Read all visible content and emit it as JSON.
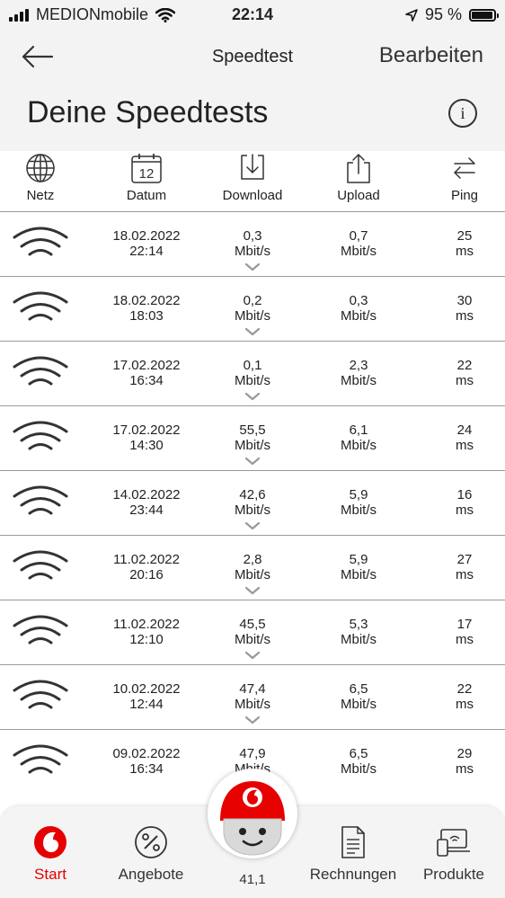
{
  "status": {
    "carrier": "MEDIONmobile",
    "time": "22:14",
    "battery": "95 %",
    "battery_level": 0.95
  },
  "header": {
    "nav_title": "Speedtest",
    "edit_label": "Bearbeiten",
    "page_title": "Deine Speedtests",
    "info_symbol": "i"
  },
  "columns": {
    "network": "Netz",
    "date": "Datum",
    "date_icon_day": "12",
    "download": "Download",
    "upload": "Upload",
    "ping": "Ping"
  },
  "rows": [
    {
      "date": "18.02.2022",
      "time": "22:14",
      "download": "0,3",
      "download_unit": "Mbit/s",
      "upload": "0,7",
      "upload_unit": "Mbit/s",
      "ping": "25",
      "ping_unit": "ms"
    },
    {
      "date": "18.02.2022",
      "time": "18:03",
      "download": "0,2",
      "download_unit": "Mbit/s",
      "upload": "0,3",
      "upload_unit": "Mbit/s",
      "ping": "30",
      "ping_unit": "ms"
    },
    {
      "date": "17.02.2022",
      "time": "16:34",
      "download": "0,1",
      "download_unit": "Mbit/s",
      "upload": "2,3",
      "upload_unit": "Mbit/s",
      "ping": "22",
      "ping_unit": "ms"
    },
    {
      "date": "17.02.2022",
      "time": "14:30",
      "download": "55,5",
      "download_unit": "Mbit/s",
      "upload": "6,1",
      "upload_unit": "Mbit/s",
      "ping": "24",
      "ping_unit": "ms"
    },
    {
      "date": "14.02.2022",
      "time": "23:44",
      "download": "42,6",
      "download_unit": "Mbit/s",
      "upload": "5,9",
      "upload_unit": "Mbit/s",
      "ping": "16",
      "ping_unit": "ms"
    },
    {
      "date": "11.02.2022",
      "time": "20:16",
      "download": "2,8",
      "download_unit": "Mbit/s",
      "upload": "5,9",
      "upload_unit": "Mbit/s",
      "ping": "27",
      "ping_unit": "ms"
    },
    {
      "date": "11.02.2022",
      "time": "12:10",
      "download": "45,5",
      "download_unit": "Mbit/s",
      "upload": "5,3",
      "upload_unit": "Mbit/s",
      "ping": "17",
      "ping_unit": "ms"
    },
    {
      "date": "10.02.2022",
      "time": "12:44",
      "download": "47,4",
      "download_unit": "Mbit/s",
      "upload": "6,5",
      "upload_unit": "Mbit/s",
      "ping": "22",
      "ping_unit": "ms"
    },
    {
      "date": "09.02.2022",
      "time": "16:34",
      "download": "47,9",
      "download_unit": "Mbit/s",
      "upload": "6,5",
      "upload_unit": "Mbit/s",
      "ping": "29",
      "ping_unit": "ms"
    }
  ],
  "tabbar": {
    "start": "Start",
    "offers": "Angebote",
    "center_label": "41,1",
    "invoices": "Rechnungen",
    "products": "Produkte"
  },
  "colors": {
    "accent": "#e60000",
    "background": "#f3f3f3",
    "divider": "#9a9a9a"
  },
  "icons": [
    "wifi-icon",
    "globe-icon",
    "calendar-icon",
    "download-icon",
    "upload-icon",
    "ping-arrows-icon",
    "back-arrow-icon",
    "info-icon",
    "vodafone-logo-icon",
    "percent-icon",
    "invoice-icon",
    "devices-icon",
    "chevron-down-icon"
  ]
}
